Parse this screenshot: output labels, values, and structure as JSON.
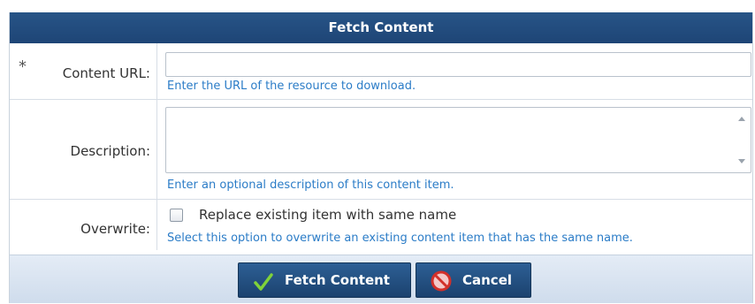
{
  "form": {
    "title": "Fetch Content",
    "content_url": {
      "required_marker": "*",
      "label": "Content URL:",
      "value": "",
      "hint": "Enter the URL of the resource to download."
    },
    "description": {
      "label": "Description:",
      "value": "",
      "hint": "Enter an optional description of this content item."
    },
    "overwrite": {
      "label": "Overwrite:",
      "checkbox_label": "Replace existing item with same name",
      "checked": false,
      "hint": "Select this option to overwrite an existing content item that has the same name."
    }
  },
  "actions": {
    "fetch_label": "Fetch Content",
    "cancel_label": "Cancel"
  },
  "colors": {
    "header_bg": "#1e4576",
    "hint_text": "#2b7cc7",
    "button_bg": "#1b426f",
    "footer_bg": "#d8e3f0"
  },
  "icons": {
    "fetch": "checkmark-icon",
    "cancel": "prohibited-icon"
  }
}
